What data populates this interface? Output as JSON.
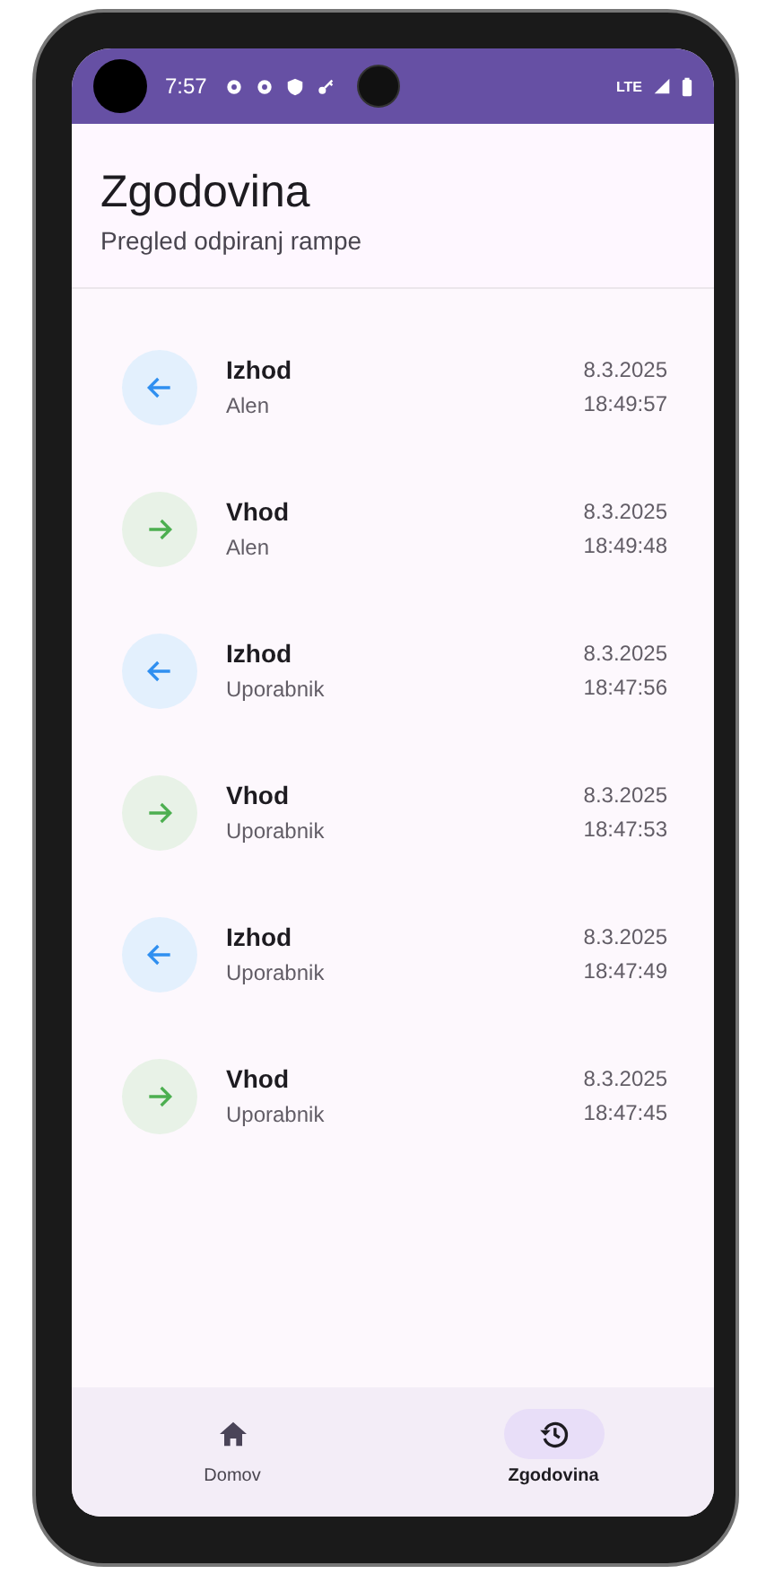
{
  "status_bar": {
    "time": "7:57",
    "network": "LTE"
  },
  "header": {
    "title": "Zgodovina",
    "subtitle": "Pregled odpiranj rampe"
  },
  "entries": [
    {
      "kind": "exit",
      "title": "Izhod",
      "user": "Alen",
      "date": "8.3.2025",
      "time": "18:49:57"
    },
    {
      "kind": "entry",
      "title": "Vhod",
      "user": "Alen",
      "date": "8.3.2025",
      "time": "18:49:48"
    },
    {
      "kind": "exit",
      "title": "Izhod",
      "user": "Uporabnik",
      "date": "8.3.2025",
      "time": "18:47:56"
    },
    {
      "kind": "entry",
      "title": "Vhod",
      "user": "Uporabnik",
      "date": "8.3.2025",
      "time": "18:47:53"
    },
    {
      "kind": "exit",
      "title": "Izhod",
      "user": "Uporabnik",
      "date": "8.3.2025",
      "time": "18:47:49"
    },
    {
      "kind": "entry",
      "title": "Vhod",
      "user": "Uporabnik",
      "date": "8.3.2025",
      "time": "18:47:45"
    }
  ],
  "nav": [
    {
      "kind": "home",
      "label": "Domov",
      "selected": false
    },
    {
      "kind": "history",
      "label": "Zgodovina",
      "selected": true
    }
  ]
}
